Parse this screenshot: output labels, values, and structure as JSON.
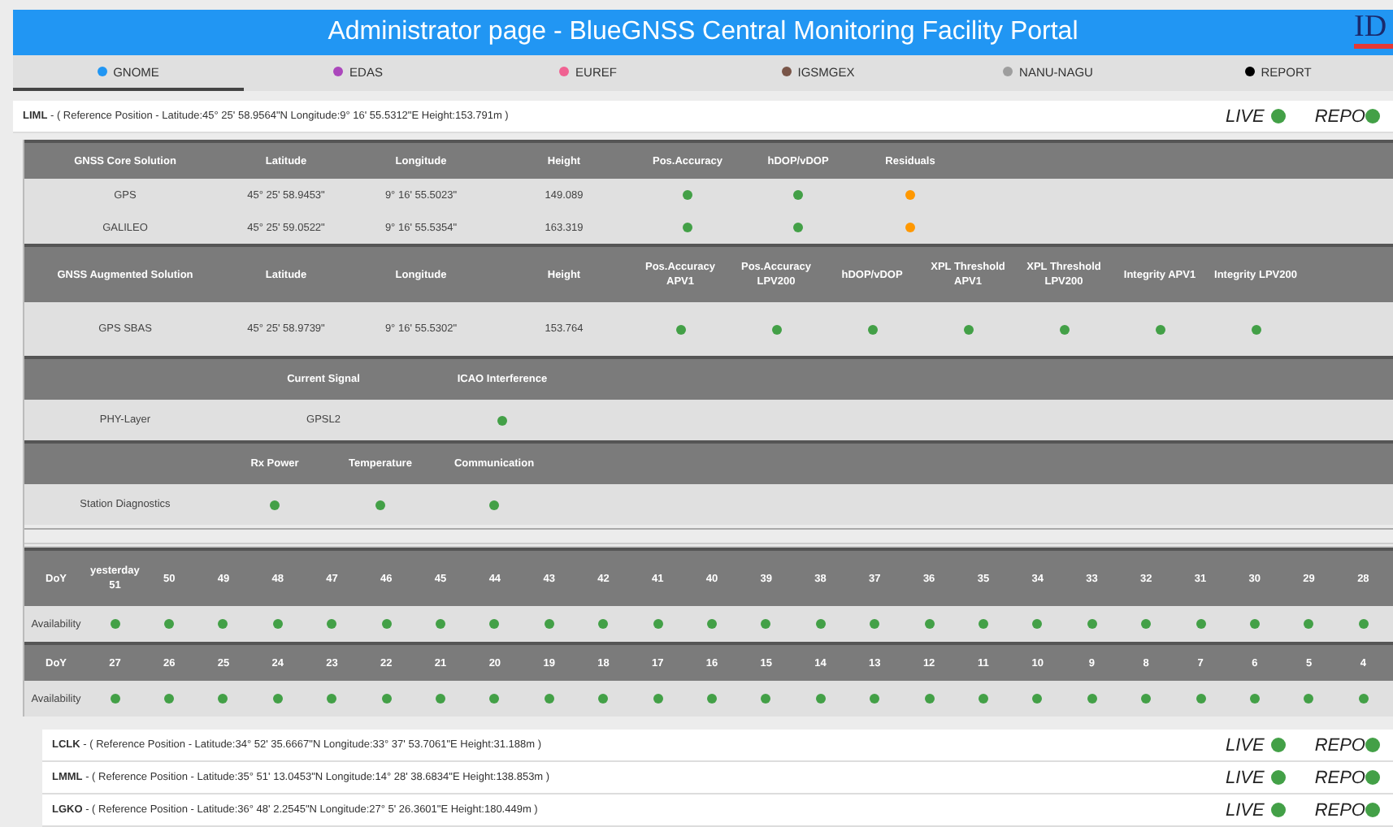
{
  "header": {
    "title": "Administrator page -  BlueGNSS Central Monitoring Facility Portal",
    "logo": "ID"
  },
  "tabs": [
    {
      "label": "GNOME",
      "color": "#2196f3",
      "selected": true
    },
    {
      "label": "EDAS",
      "color": "#ab47bc",
      "selected": false
    },
    {
      "label": "EUREF",
      "color": "#f06292",
      "selected": false
    },
    {
      "label": "IGSMGEX",
      "color": "#795548",
      "selected": false
    },
    {
      "label": "NANU-NAGU",
      "color": "#9e9e9e",
      "selected": false
    },
    {
      "label": "REPORT",
      "color": "#000000",
      "selected": false
    }
  ],
  "station": {
    "code": "LIML",
    "position": " - ( Reference Position - Latitude:45° 25' 58.9564\"N Longitude:9° 16' 55.5312\"E Height:153.791m )",
    "live": {
      "label": "LIVE",
      "color": "#43a047"
    },
    "repo": {
      "label": "REPO",
      "color": "#43a047"
    },
    "sections": [
      {
        "kind": "core",
        "header": [
          "GNSS Core Solution",
          "Latitude",
          "Longitude",
          "Height",
          "Pos.Accuracy",
          "hDOP/vDOP",
          "Residuals"
        ],
        "rows": [
          [
            {
              "text": "GPS"
            },
            {
              "text": "45° 25' 58.9453\""
            },
            {
              "text": "9° 16' 55.5023\""
            },
            {
              "text": "149.089"
            },
            {
              "color": "#43a047"
            },
            {
              "color": "#43a047"
            },
            {
              "color": "#ff9800"
            }
          ],
          [
            {
              "text": "GALILEO"
            },
            {
              "text": "45° 25' 59.0522\""
            },
            {
              "text": "9° 16' 55.5354\""
            },
            {
              "text": "163.319"
            },
            {
              "color": "#43a047"
            },
            {
              "color": "#43a047"
            },
            {
              "color": "#ff9800"
            }
          ]
        ]
      },
      {
        "kind": "augmented",
        "header": [
          "GNSS Augmented Solution",
          "Latitude",
          "Longitude",
          "Height",
          "Pos.Accuracy APV1",
          "Pos.Accuracy LPV200",
          "hDOP/vDOP",
          "XPL Threshold APV1",
          "XPL Threshold LPV200",
          "Integrity APV1",
          "Integrity LPV200"
        ],
        "rows": [
          [
            {
              "text": "GPS SBAS"
            },
            {
              "text": "45° 25' 58.9739\""
            },
            {
              "text": "9° 16' 55.5302\""
            },
            {
              "text": "153.764"
            },
            {
              "color": "#43a047"
            },
            {
              "color": "#43a047"
            },
            {
              "color": "#43a047"
            },
            {
              "color": "#43a047"
            },
            {
              "color": "#43a047"
            },
            {
              "color": "#43a047"
            },
            {
              "color": "#43a047"
            }
          ]
        ]
      },
      {
        "kind": "signal",
        "header": [
          "Current Signal",
          "ICAO Interference"
        ],
        "rows": [
          [
            {
              "text": "PHY-Layer"
            },
            {
              "text": "GPSL2"
            },
            {
              "color": "#43a047"
            }
          ]
        ]
      },
      {
        "kind": "diagnostics",
        "header": [
          "Rx Power",
          "Temperature",
          "Communication"
        ],
        "rows": [
          [
            {
              "text": "Station Diagnostics"
            },
            {
              "color": "#43a047"
            },
            {
              "color": "#43a047"
            },
            {
              "color": "#43a047"
            }
          ]
        ]
      }
    ],
    "availability": [
      {
        "day_label": "DoY",
        "value_label": "Availability",
        "days": [
          "yesterday 51",
          "50",
          "49",
          "48",
          "47",
          "46",
          "45",
          "44",
          "43",
          "42",
          "41",
          "40",
          "39",
          "38",
          "37",
          "36",
          "35",
          "34",
          "33",
          "32",
          "31",
          "30",
          "29",
          "28"
        ],
        "values": [
          {
            "color": "#43a047"
          },
          {
            "color": "#43a047"
          },
          {
            "color": "#43a047"
          },
          {
            "color": "#43a047"
          },
          {
            "color": "#43a047"
          },
          {
            "color": "#43a047"
          },
          {
            "color": "#43a047"
          },
          {
            "color": "#43a047"
          },
          {
            "color": "#43a047"
          },
          {
            "color": "#43a047"
          },
          {
            "color": "#43a047"
          },
          {
            "color": "#43a047"
          },
          {
            "color": "#43a047"
          },
          {
            "color": "#43a047"
          },
          {
            "color": "#43a047"
          },
          {
            "color": "#43a047"
          },
          {
            "color": "#43a047"
          },
          {
            "color": "#43a047"
          },
          {
            "color": "#43a047"
          },
          {
            "color": "#43a047"
          },
          {
            "color": "#43a047"
          },
          {
            "color": "#43a047"
          },
          {
            "color": "#43a047"
          },
          {
            "color": "#43a047"
          }
        ]
      },
      {
        "day_label": "DoY",
        "value_label": "Availability",
        "days": [
          "27",
          "26",
          "25",
          "24",
          "23",
          "22",
          "21",
          "20",
          "19",
          "18",
          "17",
          "16",
          "15",
          "14",
          "13",
          "12",
          "11",
          "10",
          "9",
          "8",
          "7",
          "6",
          "5",
          "4"
        ],
        "values": [
          {
            "color": "#43a047"
          },
          {
            "color": "#43a047"
          },
          {
            "color": "#43a047"
          },
          {
            "color": "#43a047"
          },
          {
            "color": "#43a047"
          },
          {
            "color": "#43a047"
          },
          {
            "color": "#43a047"
          },
          {
            "color": "#43a047"
          },
          {
            "color": "#43a047"
          },
          {
            "color": "#43a047"
          },
          {
            "color": "#43a047"
          },
          {
            "color": "#43a047"
          },
          {
            "color": "#43a047"
          },
          {
            "color": "#43a047"
          },
          {
            "color": "#43a047"
          },
          {
            "color": "#43a047"
          },
          {
            "color": "#43a047"
          },
          {
            "color": "#43a047"
          },
          {
            "color": "#43a047"
          },
          {
            "color": "#43a047"
          },
          {
            "color": "#43a047"
          },
          {
            "color": "#43a047"
          },
          {
            "color": "#43a047"
          },
          {
            "color": "#43a047"
          }
        ]
      }
    ]
  },
  "other_stations": [
    {
      "code": "LCLK",
      "position": " - ( Reference Position - Latitude:34° 52' 35.6667\"N Longitude:33° 37' 53.7061\"E Height:31.188m )",
      "live": {
        "label": "LIVE",
        "color": "#43a047"
      },
      "repo": {
        "label": "REPO",
        "color": "#43a047"
      }
    },
    {
      "code": "LMML",
      "position": " - ( Reference Position - Latitude:35° 51' 13.0453\"N Longitude:14° 28' 38.6834\"E Height:138.853m )",
      "live": {
        "label": "LIVE",
        "color": "#43a047"
      },
      "repo": {
        "label": "REPO",
        "color": "#43a047"
      }
    },
    {
      "code": "LGKO",
      "position": " - ( Reference Position - Latitude:36° 48' 2.2545\"N Longitude:27° 5' 26.3601\"E Height:180.449m )",
      "live": {
        "label": "LIVE",
        "color": "#43a047"
      },
      "repo": {
        "label": "REPO",
        "color": "#43a047"
      }
    }
  ]
}
